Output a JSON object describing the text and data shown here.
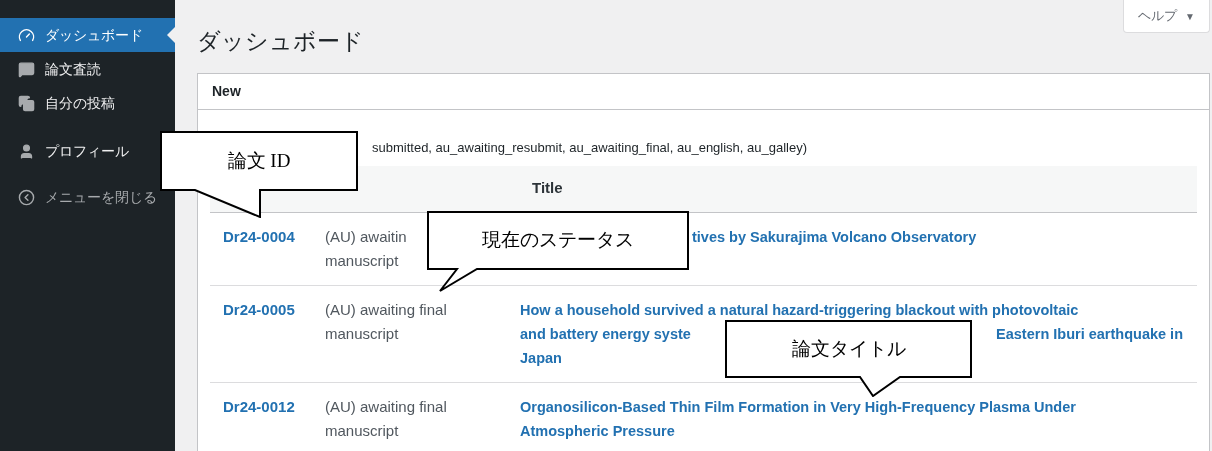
{
  "sidebar": {
    "items": [
      {
        "label": "ダッシュボード",
        "selected": true,
        "kind": "menu"
      },
      {
        "label": "論文査読",
        "selected": false,
        "kind": "menu"
      },
      {
        "label": "自分の投稿",
        "selected": false,
        "kind": "menu"
      },
      {
        "label": "プロフィール",
        "selected": false,
        "kind": "menu"
      },
      {
        "label": "メニューを閉じる",
        "selected": false,
        "kind": "collapse"
      }
    ]
  },
  "page_title": "ダッシュボード",
  "help_button": {
    "label": "ヘルプ",
    "caret": "▼"
  },
  "panel": {
    "title": "New",
    "description": "submitted, au_awaiting_resubmit, au_awaiting_final, au_english, au_galley)",
    "columns": [
      "Title"
    ],
    "rows": [
      {
        "id": "Dr24-0004",
        "status_lines": [
          "(AU) awaitin",
          "manuscript"
        ],
        "title_covered_start": true,
        "title_lines": [
          [
            "tives by Sakurajima Volcano Observatory"
          ]
        ]
      },
      {
        "id": "Dr24-0005",
        "status_lines": [
          "(AU) awaiting final",
          "manuscript"
        ],
        "title_covered_start": false,
        "title_lines": [
          [
            "How a household survived a natural hazard-triggering blackout with photovoltaic"
          ],
          [
            "and battery energy syste",
            "Eastern Iburi earthquake in"
          ],
          [
            "Japan"
          ]
        ]
      },
      {
        "id": "Dr24-0012",
        "status_lines": [
          "(AU) awaiting final",
          "manuscript"
        ],
        "title_covered_start": false,
        "title_lines": [
          [
            "Organosilicon-Based Thin Film Formation in Very High-Frequency Plasma Under"
          ],
          [
            "Atmospheric Pressure"
          ]
        ]
      }
    ]
  },
  "callouts": [
    {
      "text": "論文 ID"
    },
    {
      "text": "現在のステータス"
    },
    {
      "text": "論文タイトル"
    }
  ]
}
